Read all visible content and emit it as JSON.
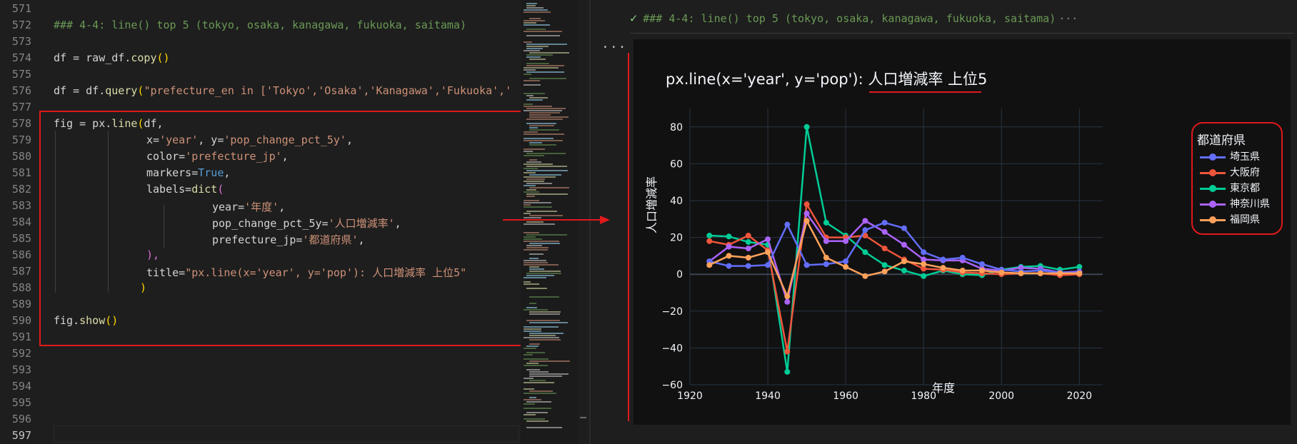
{
  "editor": {
    "line_numbers": [
      "571",
      "572",
      "573",
      "574",
      "575",
      "576",
      "577",
      "578",
      "579",
      "580",
      "581",
      "582",
      "583",
      "584",
      "585",
      "586",
      "587",
      "588",
      "589",
      "590",
      "591",
      "592",
      "593",
      "594",
      "595",
      "596",
      "597"
    ],
    "code": {
      "l572": "### 4-4: line() top 5 (tokyo, osaka, kanagawa, fukuoka, saitama)",
      "l574_a": "df = raw_df.",
      "l574_fn": "copy",
      "l574_b": "()",
      "l576_a": "df = df.",
      "l576_fn": "query",
      "l576_str": "\"prefecture_en in ['Tokyo','Osaka','Kanagawa','Fukuoka','",
      "l578_a": "fig = px.",
      "l578_fn": "line",
      "l578_b": "df,",
      "l579_a": "x=",
      "l579_s1": "'year'",
      "l579_b": ", y=",
      "l579_s2": "'pop_change_pct_5y'",
      "l579_c": ",",
      "l580_a": "color=",
      "l580_s": "'prefecture_jp'",
      "l580_b": ",",
      "l581_a": "markers=",
      "l581_kw": "True",
      "l581_b": ",",
      "l582_a": "labels=",
      "l582_fn": "dict",
      "l583_a": "year=",
      "l583_s": "'年度'",
      "l583_b": ",",
      "l584_a": "pop_change_pct_5y=",
      "l584_s": "'人口増減率'",
      "l584_b": ",",
      "l585_a": "prefecture_jp=",
      "l585_s": "'都道府県'",
      "l585_b": ",",
      "l586": "),",
      "l587_a": "title=",
      "l587_s": "\"px.line(x='year', y='pop'): 人口増減率 上位5\"",
      "l588": ")",
      "l590_a": "fig.",
      "l590_fn": "show",
      "l590_b": "()"
    }
  },
  "output": {
    "header": "### 4-4: line() top 5 (tokyo, osaka, kanagawa, fukuoka, saitama)",
    "header_ellipsis": "···",
    "more_label": "···"
  },
  "colors": {
    "accent_red": "#e0191b",
    "series": [
      "#636efa",
      "#ef553b",
      "#00cc96",
      "#ab63fa",
      "#ffa15a"
    ]
  },
  "chart_data": {
    "type": "line",
    "title": "px.line(x='year', y='pop'): 人口増減率 上位5",
    "xlabel": "年度",
    "ylabel": "人口増減率",
    "xlim": [
      1920,
      2026
    ],
    "ylim": [
      -60,
      90
    ],
    "xticks": [
      1920,
      1940,
      1960,
      1980,
      2000,
      2020
    ],
    "yticks": [
      -60,
      -40,
      -20,
      0,
      20,
      40,
      60,
      80
    ],
    "ytick_labels": [
      "−60",
      "−40",
      "−20",
      "0",
      "20",
      "40",
      "60",
      "80"
    ],
    "grid": true,
    "legend_title": "都道府県",
    "legend_placement": "right",
    "x": [
      1925,
      1930,
      1935,
      1940,
      1945,
      1950,
      1955,
      1960,
      1965,
      1970,
      1975,
      1980,
      1985,
      1990,
      1995,
      2000,
      2005,
      2010,
      2015,
      2020
    ],
    "series": [
      {
        "name": "埼玉県",
        "values": [
          7,
          4.5,
          4.5,
          5,
          27,
          5,
          5.5,
          7,
          24,
          28,
          25,
          12,
          8,
          9,
          5.5,
          2.5,
          1.5,
          2,
          1,
          1
        ]
      },
      {
        "name": "大阪府",
        "values": [
          18,
          16,
          21,
          13,
          -42,
          38,
          20,
          20,
          21,
          14,
          8,
          3,
          2.5,
          1,
          0.5,
          0,
          0.5,
          0.5,
          -0.5,
          0
        ]
      },
      {
        "name": "東京都",
        "values": [
          21,
          20.5,
          17.5,
          16,
          -53,
          80,
          28,
          21,
          12,
          5,
          2,
          -1,
          2,
          0,
          -0.5,
          2.5,
          4,
          4.5,
          2.5,
          4
        ]
      },
      {
        "name": "神奈川県",
        "values": [
          7,
          15,
          14,
          19,
          -15,
          33,
          18,
          18,
          29,
          23,
          16,
          8,
          7.5,
          7.5,
          3,
          2,
          3.5,
          3,
          1,
          1.5
        ]
      },
      {
        "name": "福岡県",
        "values": [
          5,
          10,
          9,
          12,
          -12,
          29,
          9,
          4,
          -1,
          1.5,
          7,
          5.5,
          3.5,
          2,
          2,
          1,
          0.5,
          0.5,
          0.5,
          0.5
        ]
      }
    ]
  }
}
